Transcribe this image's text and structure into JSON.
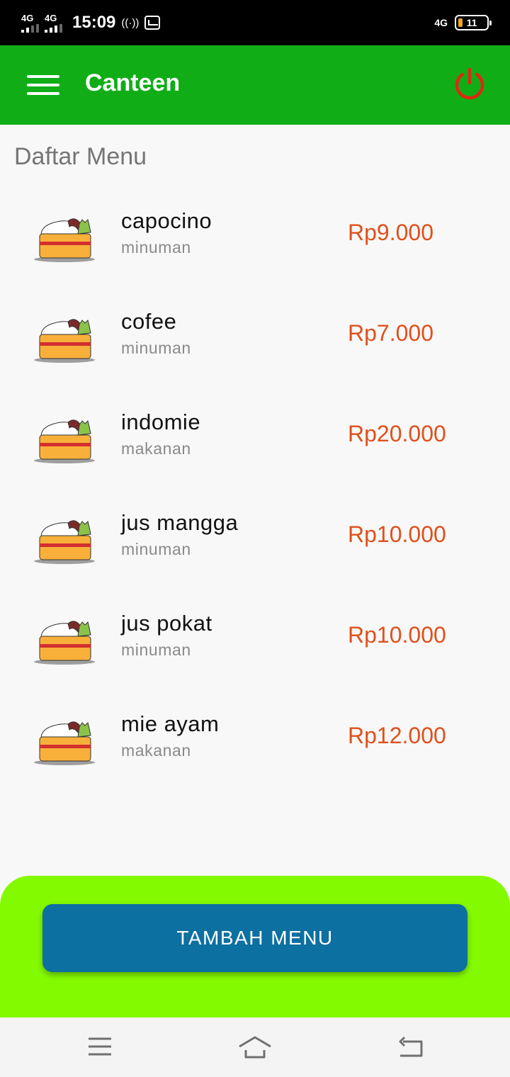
{
  "status_bar": {
    "sim1": "4G",
    "sim2": "4G",
    "time": "15:09",
    "network_right": "4G",
    "battery": "11"
  },
  "app_bar": {
    "title": "Canteen",
    "menu_icon": "hamburger-menu-icon",
    "power_icon": "power-icon",
    "power_color": "#d92b10",
    "background": "#10ad17"
  },
  "section_title": "Daftar Menu",
  "menu": [
    {
      "name": "capocino",
      "category": "minuman",
      "price": "Rp9.000"
    },
    {
      "name": "cofee",
      "category": "minuman",
      "price": "Rp7.000"
    },
    {
      "name": "indomie",
      "category": "makanan",
      "price": "Rp20.000"
    },
    {
      "name": "jus mangga",
      "category": "minuman",
      "price": "Rp10.000"
    },
    {
      "name": "jus pokat",
      "category": "minuman",
      "price": "Rp10.000"
    },
    {
      "name": "mie ayam",
      "category": "makanan",
      "price": "Rp12.000"
    }
  ],
  "add_button": {
    "label": "TAMBAH MENU",
    "color": "#0c70a1"
  },
  "bottom_panel_color": "#84fa00",
  "price_color": "#e0501c",
  "nav_bar": {
    "icons": [
      "recent-apps-icon",
      "home-icon",
      "back-icon"
    ]
  }
}
